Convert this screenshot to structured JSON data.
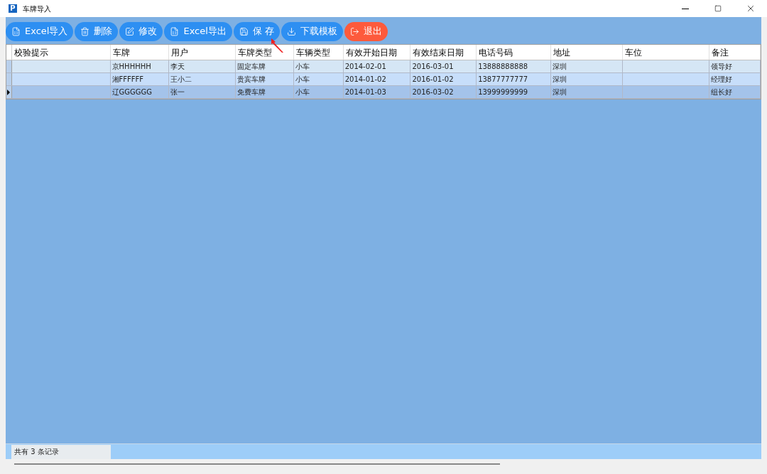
{
  "window": {
    "logo": "P",
    "title": "车牌导入"
  },
  "toolbar": [
    {
      "label": "Excel导入",
      "kind": "import"
    },
    {
      "label": "删除",
      "kind": "delete"
    },
    {
      "label": "修改",
      "kind": "edit"
    },
    {
      "label": "Excel导出",
      "kind": "export"
    },
    {
      "label": "保 存",
      "kind": "save"
    },
    {
      "label": "下载模板",
      "kind": "download"
    },
    {
      "label": "退出",
      "kind": "exit"
    }
  ],
  "table": {
    "columns": [
      "校验提示",
      "车牌",
      "用户",
      "车牌类型",
      "车辆类型",
      "有效开始日期",
      "有效结束日期",
      "电话号码",
      "地址",
      "车位",
      "备注"
    ],
    "rows": [
      {
        "selected": false,
        "cells": [
          "",
          "京HHHHHH",
          "李天",
          "固定车牌",
          "小车",
          "2014-02-01",
          "2016-03-01",
          "13888888888",
          "深圳",
          "",
          "领导好"
        ]
      },
      {
        "selected": false,
        "cells": [
          "",
          "湘FFFFFF",
          "王小二",
          "贵宾车牌",
          "小车",
          "2014-01-02",
          "2016-01-02",
          "13877777777",
          "深圳",
          "",
          "经理好"
        ]
      },
      {
        "selected": true,
        "cells": [
          "",
          "辽GGGGGG",
          "张一",
          "免费车牌",
          "小车",
          "2014-01-03",
          "2016-03-02",
          "13999999999",
          "深圳",
          "",
          "组长好"
        ]
      }
    ]
  },
  "status_bar": "共有 3 条记录"
}
